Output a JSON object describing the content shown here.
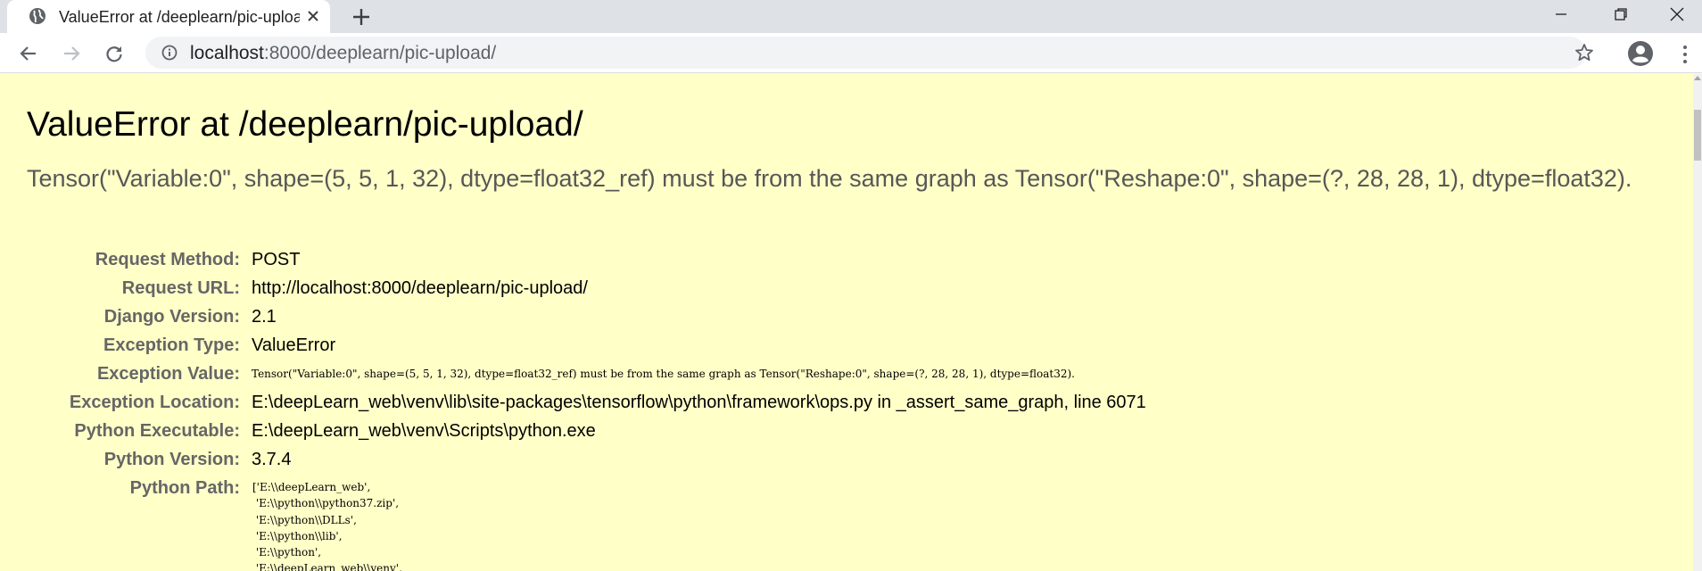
{
  "browser": {
    "tab_title": "ValueError at /deeplearn/pic-upload/",
    "url_host": "localhost",
    "url_path": ":8000/deeplearn/pic-upload/"
  },
  "page": {
    "title": "ValueError at /deeplearn/pic-upload/",
    "message": "Tensor(\"Variable:0\", shape=(5, 5, 1, 32), dtype=float32_ref) must be from the same graph as Tensor(\"Reshape:0\", shape=(?, 28, 28, 1), dtype=float32).",
    "meta": [
      {
        "label": "Request Method:",
        "value": "POST"
      },
      {
        "label": "Request URL:",
        "value": "http://localhost:8000/deeplearn/pic-upload/"
      },
      {
        "label": "Django Version:",
        "value": "2.1"
      },
      {
        "label": "Exception Type:",
        "value": "ValueError"
      },
      {
        "label": "Exception Value:",
        "value": "Tensor(\"Variable:0\", shape=(5, 5, 1, 32), dtype=float32_ref) must be from the same graph as Tensor(\"Reshape:0\", shape=(?, 28, 28, 1), dtype=float32)."
      },
      {
        "label": "Exception Location:",
        "value": "E:\\deepLearn_web\\venv\\lib\\site-packages\\tensorflow\\python\\framework\\ops.py in _assert_same_graph, line 6071"
      },
      {
        "label": "Python Executable:",
        "value": "E:\\deepLearn_web\\venv\\Scripts\\python.exe"
      },
      {
        "label": "Python Version:",
        "value": "3.7.4"
      },
      {
        "label": "Python Path:",
        "value": ""
      }
    ],
    "python_path": [
      "['E:\\\\deepLearn_web',",
      " 'E:\\\\python\\\\python37.zip',",
      " 'E:\\\\python\\\\DLLs',",
      " 'E:\\\\python\\\\lib',",
      " 'E:\\\\python',",
      " 'E:\\\\deepLearn_web\\\\venv',"
    ]
  },
  "icons": {
    "favicon": "globe-icon",
    "close": "close-icon",
    "new_tab": "plus-icon",
    "back": "arrow-left-icon",
    "forward": "arrow-right-icon",
    "reload": "reload-icon",
    "info": "info-icon",
    "bookmark": "star-icon",
    "profile": "account-icon",
    "menu": "kebab-menu-icon"
  },
  "colors": {
    "page_background": "#ffffc8",
    "label": "#666666",
    "message": "#575757"
  }
}
